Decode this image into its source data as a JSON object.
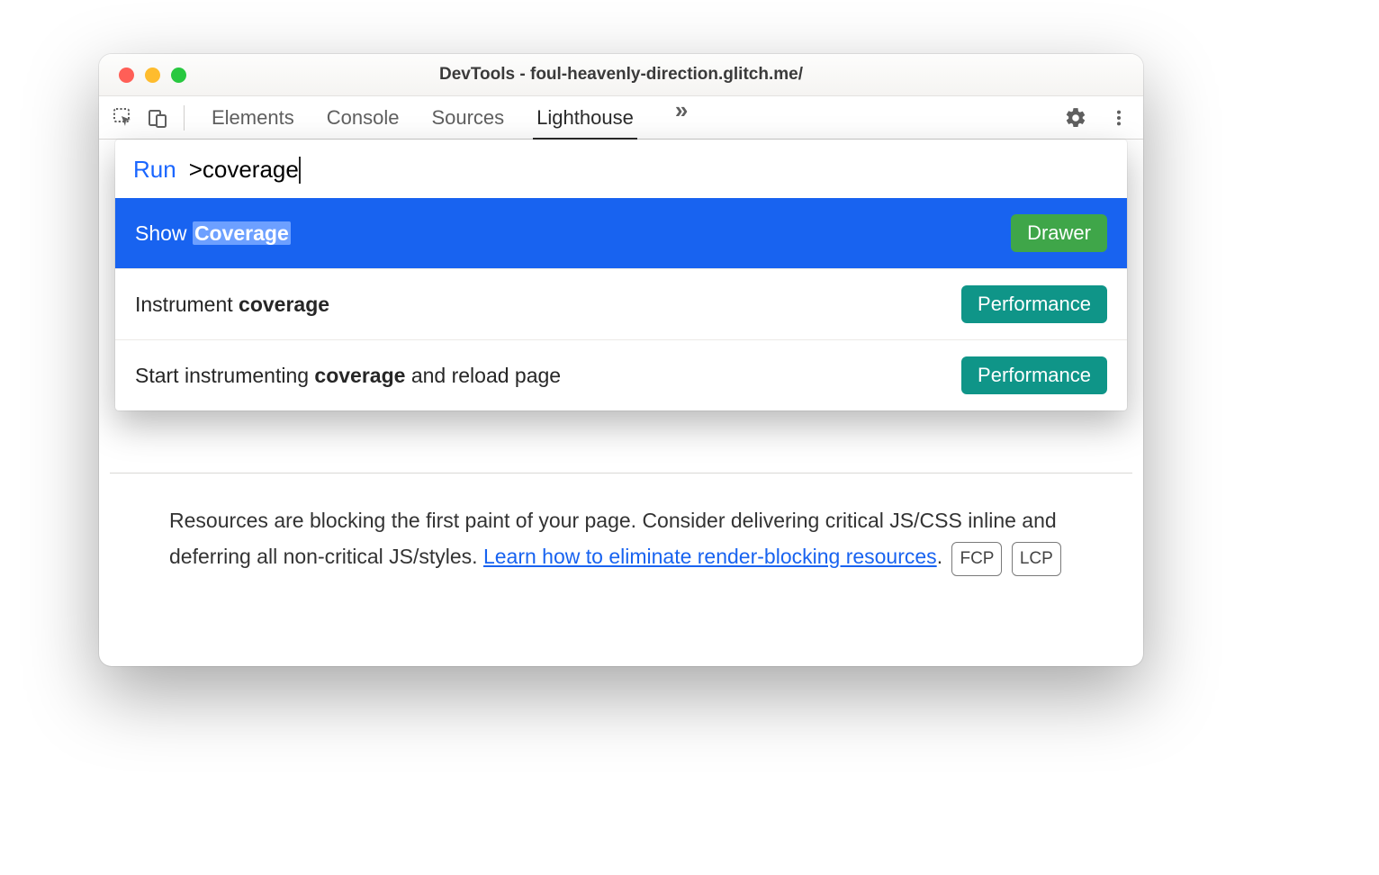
{
  "window": {
    "title": "DevTools - foul-heavenly-direction.glitch.me/"
  },
  "toolbar": {
    "tabs": [
      "Elements",
      "Console",
      "Sources",
      "Lighthouse"
    ],
    "active_tab_index": 3
  },
  "palette": {
    "prefix": "Run",
    "query": ">coverage",
    "items": [
      {
        "pre": "Show ",
        "match": "Coverage",
        "post": "",
        "badge": "Drawer",
        "badge_kind": "drawer",
        "selected": true
      },
      {
        "pre": "Instrument ",
        "match": "coverage",
        "post": "",
        "badge": "Performance",
        "badge_kind": "perf",
        "selected": false
      },
      {
        "pre": "Start instrumenting ",
        "match": "coverage",
        "post": " and reload page",
        "badge": "Performance",
        "badge_kind": "perf",
        "selected": false
      }
    ]
  },
  "explainer": {
    "text_a": "Resources are blocking the first paint of your page. Consider delivering critical JS/CSS inline and deferring all non-critical JS/styles. ",
    "link": "Learn how to eliminate render-blocking resources",
    "text_b": ".",
    "badges": [
      "FCP",
      "LCP"
    ]
  }
}
